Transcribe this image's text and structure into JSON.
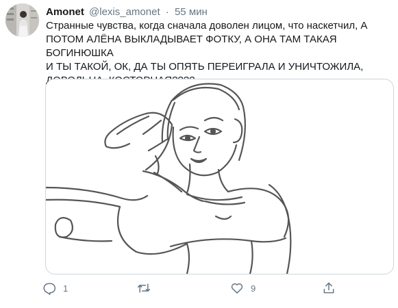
{
  "tweet": {
    "author": {
      "name": "Amonet",
      "handle": "@lexis_amonet",
      "avatar_icon": "profile-photo"
    },
    "separator": "·",
    "timestamp": "55 мин",
    "text": "Странные чувства, когда сначала доволен лицом, что наскетчил, А\nПОТОМ АЛЁНА ВЫКЛАДЫВАЕТ ФОТКУ, А ОНА ТАМ ТАКАЯ БОГИНЮШКА\nИ ТЫ ТАКОЙ, ОК, ДА ТЫ ОПЯТЬ ПЕРЕИГРАЛА И УНИЧТОЖИЛА,\nДОВОЛЬНА, КОСТОРНАЯ????",
    "media": {
      "type": "sketch-image"
    },
    "actions": {
      "reply": {
        "icon": "reply-icon",
        "count": "1"
      },
      "retweet": {
        "icon": "retweet-icon",
        "count": ""
      },
      "like": {
        "icon": "heart-icon",
        "count": "9"
      },
      "share": {
        "icon": "share-icon",
        "count": ""
      }
    }
  },
  "colors": {
    "text": "#14171a",
    "secondary": "#657786",
    "border": "#ccd6dd"
  }
}
